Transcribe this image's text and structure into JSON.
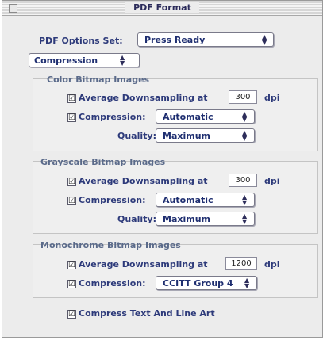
{
  "window": {
    "title": "PDF Format"
  },
  "options_set": {
    "label": "PDF Options Set:",
    "value": "Press Ready"
  },
  "panel_selector": {
    "value": "Compression"
  },
  "color": {
    "title": "Color Bitmap Images",
    "downsample_label": "Average Downsampling at",
    "dpi_value": "300",
    "dpi_unit": "dpi",
    "compression_label": "Compression:",
    "compression_value": "Automatic",
    "quality_label": "Quality:",
    "quality_value": "Maximum"
  },
  "grayscale": {
    "title": "Grayscale Bitmap Images",
    "downsample_label": "Average Downsampling at",
    "dpi_value": "300",
    "dpi_unit": "dpi",
    "compression_label": "Compression:",
    "compression_value": "Automatic",
    "quality_label": "Quality:",
    "quality_value": "Maximum"
  },
  "monochrome": {
    "title": "Monochrome Bitmap Images",
    "downsample_label": "Average Downsampling at",
    "dpi_value": "1200",
    "dpi_unit": "dpi",
    "compression_label": "Compression:",
    "compression_value": "CCITT Group 4"
  },
  "compress_text": {
    "label": "Compress Text And Line Art"
  },
  "icons": {
    "checkbox_mark": "☑",
    "popup_arrows": "up-down-arrows-icon"
  }
}
